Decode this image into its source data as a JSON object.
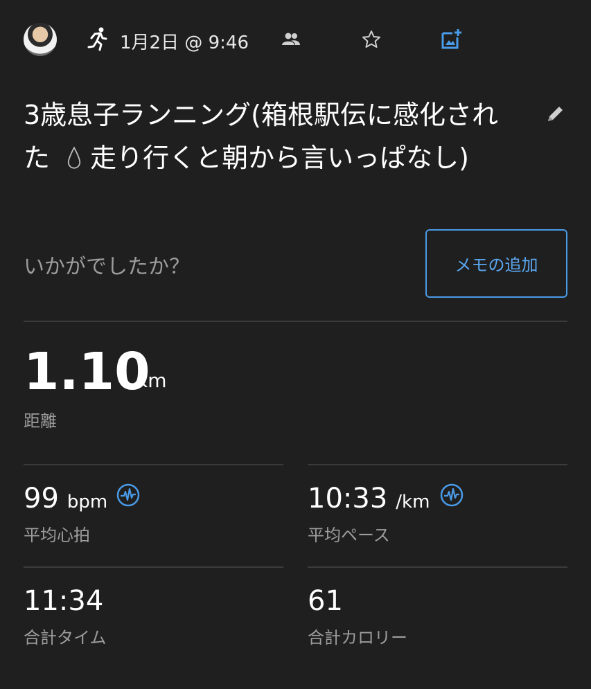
{
  "header": {
    "date_time": "1月2日 @ 9:46",
    "avatar_icon": "user-avatar",
    "activity_icon": "running-icon",
    "people_icon": "people-icon",
    "star_icon": "star-icon",
    "photo_icon": "add-photo-icon"
  },
  "title": {
    "part1": "3歳息子ランニング(箱根駅伝に感化された",
    "part2": "走り行くと朝から言いっぱなし)",
    "edit_icon": "pencil-icon",
    "emoji_icon": "droplet-icon"
  },
  "feedback": {
    "prompt": "いかがでしたか？",
    "memo_button": "メモの追加"
  },
  "distance": {
    "value": "1.10",
    "unit": "km",
    "label": "距離"
  },
  "stats": {
    "heart_rate": {
      "value": "99",
      "unit": "bpm",
      "label": "平均心拍"
    },
    "pace": {
      "value": "10:33",
      "unit": "/km",
      "label": "平均ペース"
    },
    "total_time": {
      "value": "11:34",
      "label": "合計タイム"
    },
    "calories": {
      "value": "61",
      "label": "合計カロリー"
    }
  },
  "colors": {
    "background": "#1f1f1f",
    "accent": "#4a9be8",
    "secondary_text": "#9c9c9c",
    "divider": "#3b3b3b"
  }
}
